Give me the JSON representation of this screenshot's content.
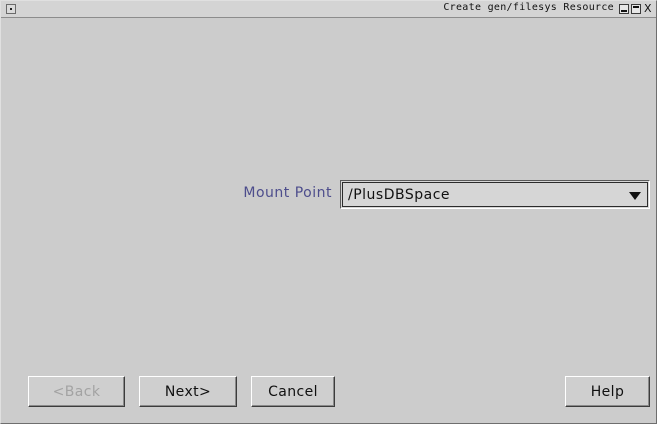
{
  "window": {
    "title": "Create gen/filesys Resource",
    "close_glyph": "X"
  },
  "form": {
    "mount_point_label": "Mount Point",
    "mount_point_value": "/PlusDBSpace"
  },
  "buttons": {
    "back": "<Back",
    "next": "Next>",
    "cancel": "Cancel",
    "help": "Help"
  },
  "state": {
    "back_enabled": false
  }
}
